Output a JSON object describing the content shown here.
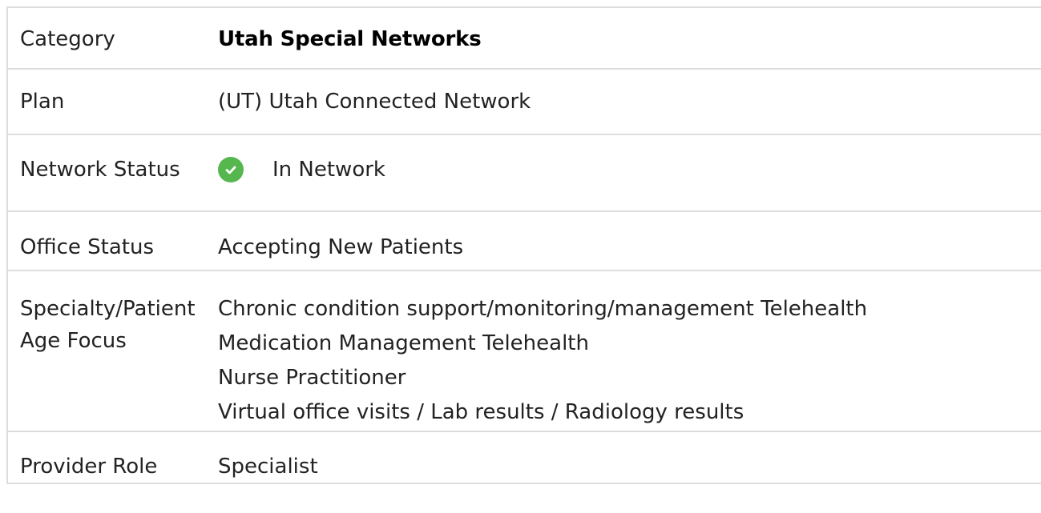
{
  "table": {
    "rows": [
      {
        "label": "Category",
        "value": "Utah Special Networks"
      },
      {
        "label": "Plan",
        "value": "(UT) Utah Connected Network"
      },
      {
        "label": "Network Status",
        "value": "In Network",
        "icon": "check-circle-icon",
        "icon_color": "#55b74e"
      },
      {
        "label": "Office Status",
        "value": "Accepting New Patients"
      },
      {
        "label": "Specialty/Patient Age Focus",
        "values": [
          "Chronic condition support/monitoring/management Telehealth",
          "Medication Management Telehealth",
          "Nurse Practitioner",
          "Virtual office visits / Lab results / Radiology results"
        ]
      },
      {
        "label": "Provider Role",
        "value": "Specialist"
      }
    ]
  }
}
